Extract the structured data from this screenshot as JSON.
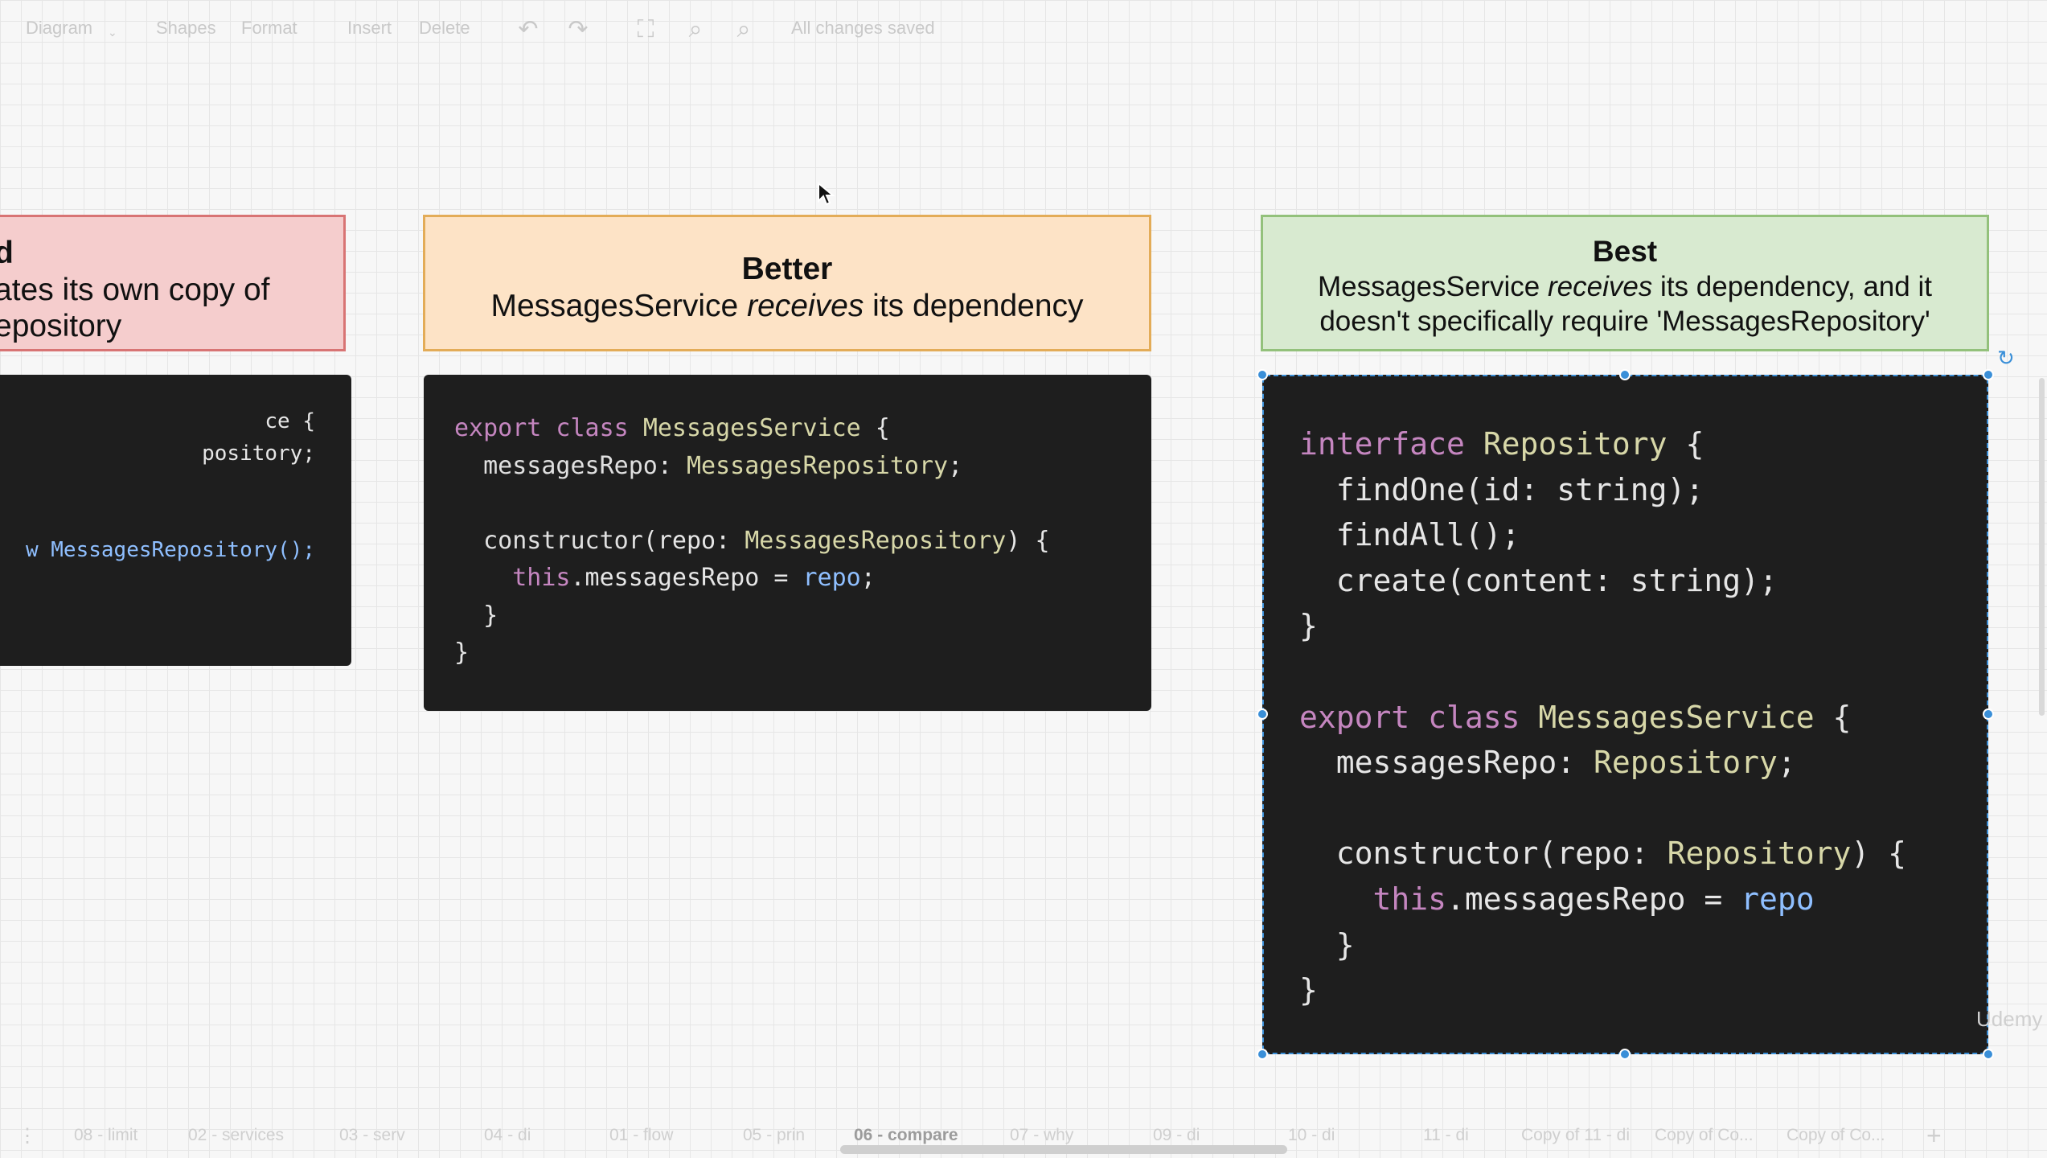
{
  "toolbar": {
    "diagram": "Diagram",
    "shapes": "Shapes",
    "format": "Format",
    "insert": "Insert",
    "delete": "Delete",
    "status": "All changes saved",
    "icons": [
      "undo-icon",
      "redo-icon",
      "fullscreen-icon",
      "zoom-in-icon",
      "zoom-out-icon"
    ]
  },
  "bad": {
    "title_fragment": "d",
    "line1": "ates its own copy of",
    "line2": "epository",
    "code": [
      "ce {",
      "pository;",
      "",
      "",
      "w MessagesRepository();"
    ]
  },
  "better": {
    "title": "Better",
    "desc_before": "MessagesService ",
    "desc_em": "receives",
    "desc_after": " its dependency"
  },
  "best": {
    "title": "Best",
    "desc1_before": "MessagesService ",
    "desc1_em": "receives",
    "desc1_after": " its dependency, and it",
    "desc2": "doesn't specifically require 'MessagesRepository'"
  },
  "pages": {
    "tabs": [
      "08 - limit",
      "02 - services",
      "03 - serv",
      "04 - di",
      "01 - flow",
      "05 - prin",
      "06 - compare",
      "07 - why",
      "09 - di",
      "10 - di",
      "11 - di",
      "Copy of 11 - di",
      "Copy of Co...",
      "Copy of Co..."
    ],
    "active_index": 6
  },
  "watermark": "Udemy",
  "colors": {
    "bad_fill": "#f5cdcd",
    "better_fill": "#fde3c6",
    "best_fill": "#d8ead0",
    "code_bg": "#1e1e1e",
    "selection": "#3a8fd8"
  }
}
